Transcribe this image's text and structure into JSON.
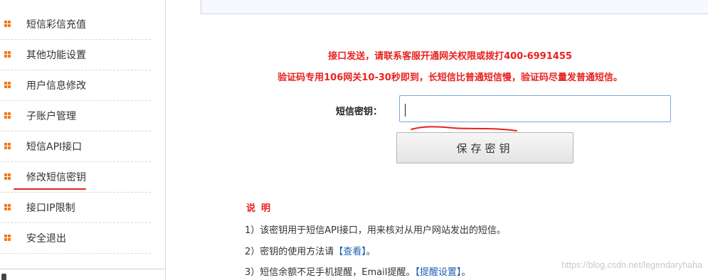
{
  "sidebar": {
    "items": [
      {
        "label": "短信彩信充值"
      },
      {
        "label": "其他功能设置"
      },
      {
        "label": "用户信息修改"
      },
      {
        "label": "子账户管理"
      },
      {
        "label": "短信API接口"
      },
      {
        "label": "修改短信密钥"
      },
      {
        "label": "接口IP限制"
      },
      {
        "label": "安全退出"
      }
    ],
    "bullet_color": "#f07a1e"
  },
  "notices": {
    "line1": "接口发送，请联系客服开通网关权限或拨打400-6991455",
    "line2": "验证码专用106网关10-30秒即到，长短信比普通短信慢，验证码尽量发普通短信。",
    "color": "#e8221f"
  },
  "form": {
    "key_label": "短信密钥：",
    "key_value": "",
    "save_label": "保存密钥"
  },
  "description": {
    "title": "说明",
    "line1": "1）该密钥用于短信API接口，用来核对从用户网站发出的短信。",
    "line2_prefix": "2）密钥的使用方法请",
    "line2_link": "【查看】",
    "line2_suffix": "。",
    "line3_prefix": "3）短信余额不足手机提醒，Email提醒。",
    "line3_link": "【提醒设置】",
    "line3_suffix": "。"
  },
  "watermark": "https://blog.csdn.net/legendaryhaha",
  "annotation_color": "#e8221f"
}
